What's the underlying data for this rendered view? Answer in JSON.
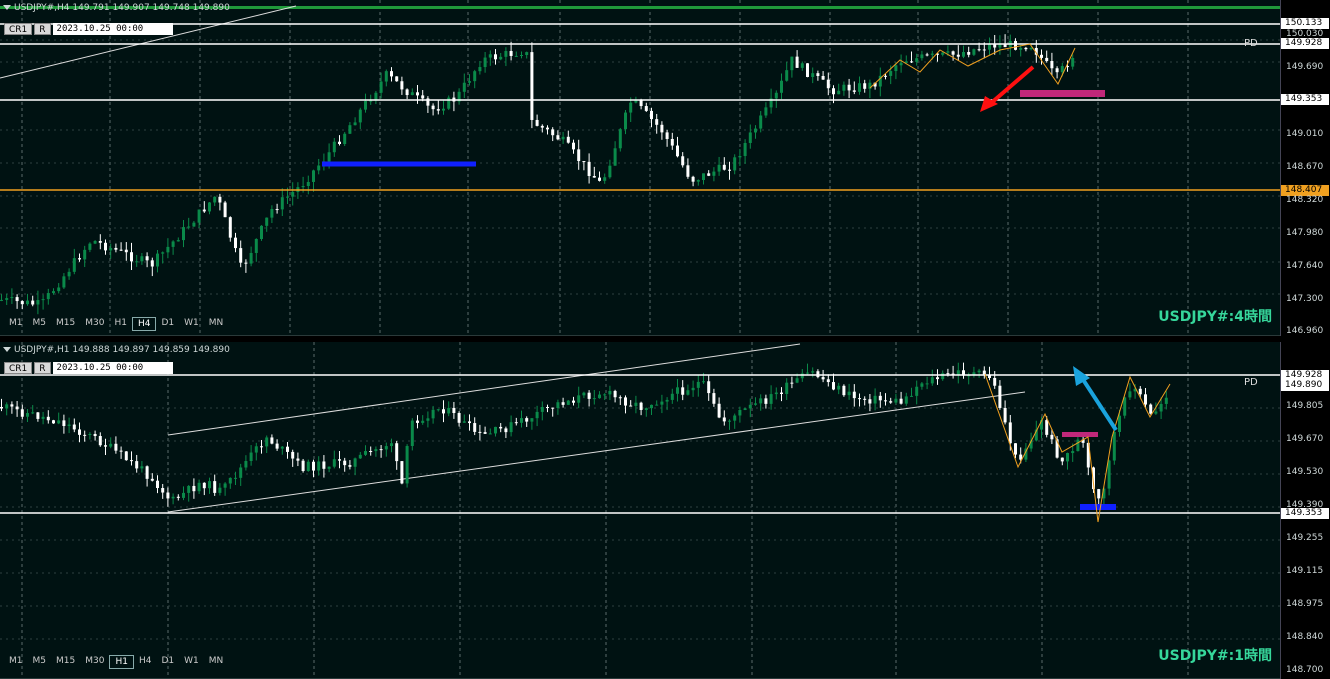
{
  "top": {
    "header": "USDJPY#,H4  149.791 149.907 149.748 149.890",
    "toolbar": {
      "cr": "CR1",
      "r": "R",
      "datetime": "2023.10.25 00:00"
    },
    "timeframes": [
      "M1",
      "M5",
      "M15",
      "M30",
      "H1",
      "H4",
      "D1",
      "W1",
      "MN"
    ],
    "active_timeframe": "H4",
    "label": "USDJPY#:4時間",
    "pd": "PD",
    "y_labels": [
      "150.030",
      "149.690",
      "149.010",
      "148.670",
      "148.320",
      "147.980",
      "147.640",
      "147.300",
      "146.960"
    ],
    "tags": {
      "a": "150.133",
      "b": "149.928",
      "c": "149.353",
      "d": "148.407",
      "e": "149.690"
    }
  },
  "bottom": {
    "header": "USDJPY#,H1  149.888 149.897 149.859 149.890",
    "toolbar": {
      "cr": "CR1",
      "r": "R",
      "datetime": "2023.10.25 00:00"
    },
    "timeframes": [
      "M1",
      "M5",
      "M15",
      "M30",
      "H1",
      "H4",
      "D1",
      "W1",
      "MN"
    ],
    "active_timeframe": "H1",
    "label": "USDJPY#:1時間",
    "pd": "PD",
    "y_labels": [
      "149.805",
      "149.670",
      "149.530",
      "149.390",
      "149.255",
      "149.115",
      "148.975",
      "148.840",
      "148.700"
    ],
    "tags": {
      "a": "149.928",
      "b": "149.890",
      "c": "149.353"
    }
  },
  "colors": {
    "bg": "#001212",
    "bull": "#0a8a4a",
    "bear": "#ffffff",
    "level": "#ffffff",
    "orange": "#f0a020",
    "blue": "#1020ff",
    "magenta": "#c0287a",
    "red": "#ff1010",
    "cyan": "#1aa3dd",
    "label": "#36d79b"
  }
}
